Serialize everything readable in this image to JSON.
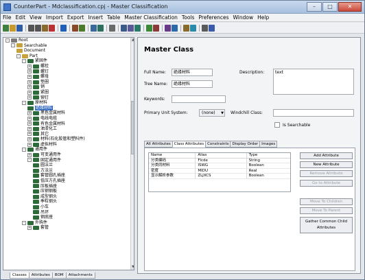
{
  "window": {
    "title": "CounterPart - Mdclassification.cpj - Master Classification"
  },
  "menu": [
    "File",
    "Edit",
    "View",
    "Import",
    "Export",
    "Insert",
    "Table",
    "Master Classification",
    "Tools",
    "Preferences",
    "Window",
    "Help"
  ],
  "toolbar_icons": [
    {
      "name": "new-icon",
      "color": "#3f7f3f"
    },
    {
      "name": "open-icon",
      "color": "#c89a2c"
    },
    {
      "name": "save-icon",
      "color": "#2d5ca8"
    },
    {
      "name": "sep"
    },
    {
      "name": "cut-icon",
      "color": "#555555"
    },
    {
      "name": "copy-icon",
      "color": "#555555"
    },
    {
      "name": "paste-icon",
      "color": "#8a6a2a"
    },
    {
      "name": "delete-icon",
      "color": "#b83232"
    },
    {
      "name": "sep"
    },
    {
      "name": "help-icon",
      "color": "#1f5fb8"
    },
    {
      "name": "sep"
    },
    {
      "name": "find-icon",
      "color": "#8a4a2a"
    },
    {
      "name": "filter-icon",
      "color": "#4a7a2a"
    },
    {
      "name": "sep"
    },
    {
      "name": "table-icon",
      "color": "#3a6a9a"
    },
    {
      "name": "grid-icon",
      "color": "#2f6f5f"
    },
    {
      "name": "sep"
    },
    {
      "name": "tree-icon",
      "color": "#6a6a6a"
    },
    {
      "name": "sep"
    },
    {
      "name": "sort-icon",
      "color": "#3a5a8a"
    },
    {
      "name": "group-icon",
      "color": "#5a5a9a"
    },
    {
      "name": "link-icon",
      "color": "#2a7a6a"
    },
    {
      "name": "sep"
    },
    {
      "name": "import-icon",
      "color": "#3a8a3a"
    },
    {
      "name": "export-icon",
      "color": "#8a3a3a"
    },
    {
      "name": "sep"
    },
    {
      "name": "class-icon",
      "color": "#6a3a8a"
    },
    {
      "name": "attribute-icon",
      "color": "#2a6aaa"
    },
    {
      "name": "sep"
    },
    {
      "name": "report-icon",
      "color": "#8a6a2a"
    },
    {
      "name": "chart-icon",
      "color": "#2a8aaa"
    },
    {
      "name": "sep"
    },
    {
      "name": "settings-icon",
      "color": "#5a5a5a"
    },
    {
      "name": "window-icon",
      "color": "#3a5aaa"
    }
  ],
  "tree": [
    {
      "label": "Root",
      "level": 0,
      "exp": "-",
      "icon": "#7a7a7a"
    },
    {
      "label": "Searchable",
      "level": 1,
      "exp": "-",
      "icon": "#c9a13a"
    },
    {
      "label": "Document",
      "level": 2,
      "exp": "",
      "icon": "#c9a13a"
    },
    {
      "label": "Part",
      "level": 2,
      "exp": "-",
      "icon": "#c9a13a"
    },
    {
      "label": "紧固件",
      "level": 3,
      "exp": "-",
      "icon": "#2d6b3a"
    },
    {
      "label": "螺栓",
      "level": 4,
      "exp": "+",
      "icon": "#2d6b3a"
    },
    {
      "label": "螺钉",
      "level": 4,
      "exp": "+",
      "icon": "#2d6b3a"
    },
    {
      "label": "螺母",
      "level": 4,
      "exp": "+",
      "icon": "#2d6b3a"
    },
    {
      "label": "垫圈",
      "level": 4,
      "exp": "+",
      "icon": "#2d6b3a"
    },
    {
      "label": "销",
      "level": 4,
      "exp": "+",
      "icon": "#2d6b3a"
    },
    {
      "label": "紧圈",
      "level": 4,
      "exp": "+",
      "icon": "#2d6b3a"
    },
    {
      "label": "铆钉",
      "level": 4,
      "exp": "+",
      "icon": "#2d6b3a"
    },
    {
      "label": "原材料",
      "level": 3,
      "exp": "-",
      "icon": "#2d6b3a"
    },
    {
      "label": "绝缘材料",
      "level": 4,
      "exp": "",
      "icon": "#2d6b3a",
      "selected": true
    },
    {
      "label": "黑色金属材料",
      "level": 4,
      "exp": "+",
      "icon": "#2d6b3a"
    },
    {
      "label": "电线电缆",
      "level": 4,
      "exp": "+",
      "icon": "#2d6b3a"
    },
    {
      "label": "有色金属材料",
      "level": 4,
      "exp": "+",
      "icon": "#2d6b3a"
    },
    {
      "label": "油漆化工",
      "level": 4,
      "exp": "+",
      "icon": "#2d6b3a"
    },
    {
      "label": "其它",
      "level": 4,
      "exp": "+",
      "icon": "#2d6b3a"
    },
    {
      "label": "材料(石化胶管和塑料件)",
      "level": 4,
      "exp": "+",
      "icon": "#2d6b3a"
    },
    {
      "label": "虚拟材料",
      "level": 4,
      "exp": "+",
      "icon": "#2d6b3a"
    },
    {
      "label": "通用件",
      "level": 3,
      "exp": "-",
      "icon": "#2d6b3a"
    },
    {
      "label": "可变通用件",
      "level": 4,
      "exp": "+",
      "icon": "#2d6b3a"
    },
    {
      "label": "固定通用件",
      "level": 4,
      "exp": "-",
      "icon": "#2d6b3a"
    },
    {
      "label": "圆法兰",
      "level": 5,
      "exp": "",
      "icon": "#2d6b3a"
    },
    {
      "label": "方法兰",
      "level": 5,
      "exp": "",
      "icon": "#2d6b3a"
    },
    {
      "label": "套管圆孔插座",
      "level": 5,
      "exp": "",
      "icon": "#2d6b3a"
    },
    {
      "label": "低压方孔插座",
      "level": 5,
      "exp": "",
      "icon": "#2d6b3a"
    },
    {
      "label": "压板插座",
      "level": 5,
      "exp": "",
      "icon": "#2d6b3a"
    },
    {
      "label": "压钢钢板",
      "level": 5,
      "exp": "",
      "icon": "#2d6b3a"
    },
    {
      "label": "成型钢头",
      "level": 5,
      "exp": "",
      "icon": "#2d6b3a"
    },
    {
      "label": "季粒钢头",
      "level": 5,
      "exp": "",
      "icon": "#2d6b3a"
    },
    {
      "label": "小车",
      "level": 5,
      "exp": "",
      "icon": "#2d6b3a"
    },
    {
      "label": "吊环",
      "level": 5,
      "exp": "",
      "icon": "#2d6b3a"
    },
    {
      "label": "钢底座",
      "level": 5,
      "exp": "",
      "icon": "#2d6b3a"
    },
    {
      "label": "外购件",
      "level": 3,
      "exp": "-",
      "icon": "#2d6b3a"
    },
    {
      "label": "套管",
      "level": 4,
      "exp": "+",
      "icon": "#2d6b3a"
    }
  ],
  "bottom_tabs": [
    "Classes",
    "Attributes",
    "BOM",
    "Attachments"
  ],
  "master_class": {
    "heading": "Master Class",
    "full_name_label": "Full Name:",
    "full_name": "绝缘材料",
    "tree_name_label": "Tree Name:",
    "tree_name": "绝缘材料",
    "keywords_label": "Keywords:",
    "keywords": "",
    "description_label": "Description:",
    "description": "text",
    "unit_label": "Primary Unit System:",
    "unit": "(none)",
    "windchill_label": "Windchill Class:",
    "windchill": "",
    "searchable_label": "Is Searchable"
  },
  "detail_tabs": [
    "All Attributes",
    "Class Attributes",
    "Constraints",
    "Display Order",
    "Images"
  ],
  "attr_table": {
    "headers": [
      "Name",
      "Alias",
      "Type"
    ],
    "rows": [
      [
        "分类编码",
        "Flcde",
        "String"
      ],
      [
        "分类同材料",
        "ISWG",
        "Boolean"
      ],
      [
        "密度",
        "MIDU",
        "Real"
      ],
      [
        "显示解析参数",
        "ZLJXCS",
        "Boolean"
      ]
    ]
  },
  "attr_buttons": {
    "add": "Add Attribute",
    "new": "New Attribute",
    "remove": "Remove Attribute",
    "goto": "Go to Attribute",
    "move_children": "Move To Children",
    "move_parent": "Move To Parent",
    "gather": "Gather Common Child Attributes"
  }
}
